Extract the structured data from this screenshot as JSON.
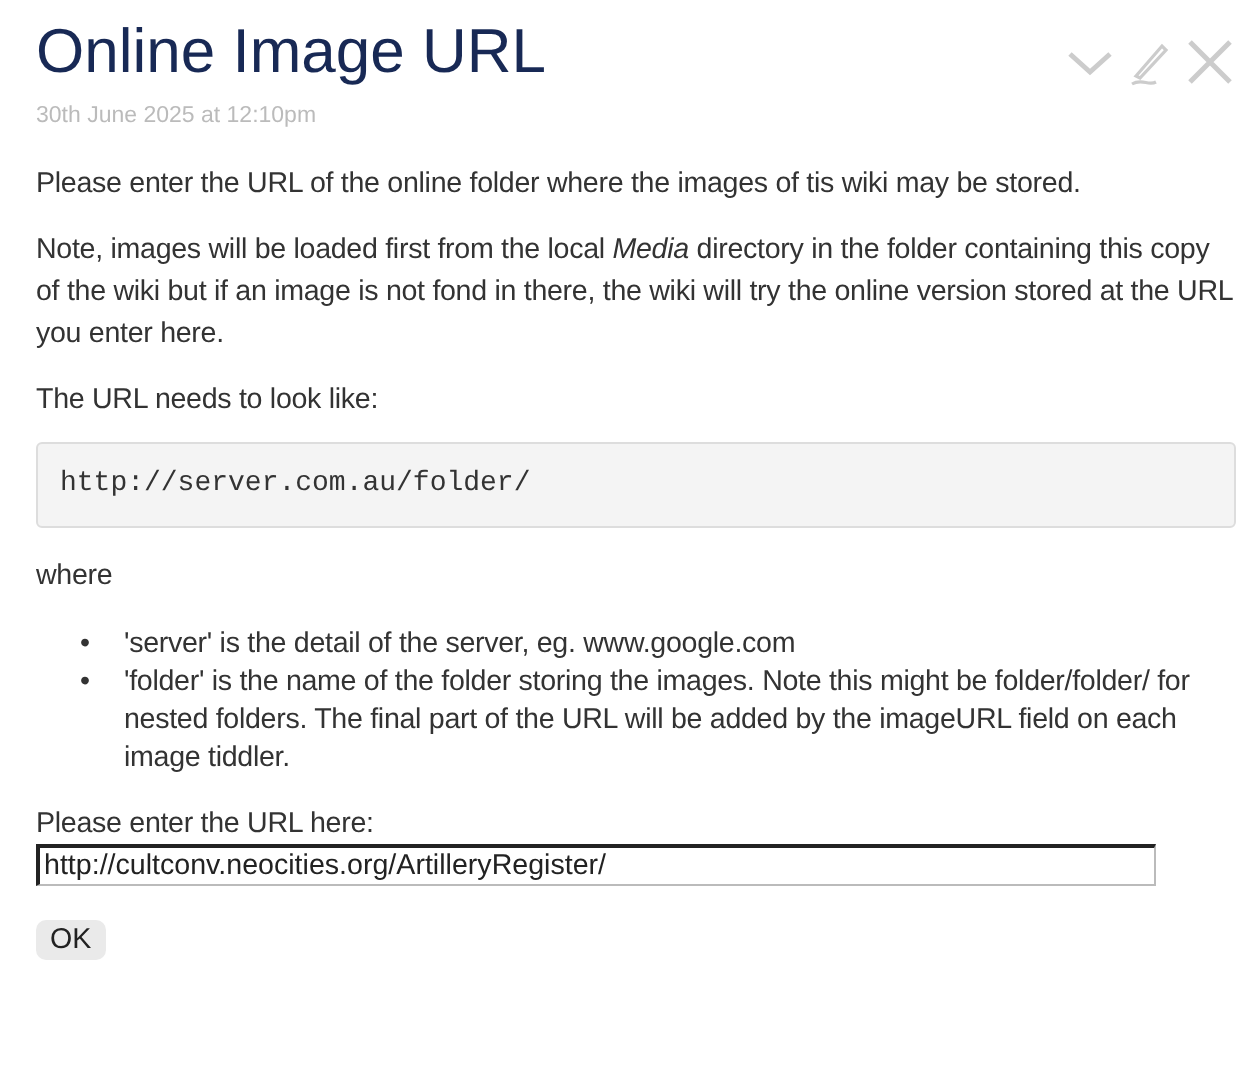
{
  "tiddler": {
    "title": "Online Image URL",
    "subtitle": "30th June 2025 at 12:10pm"
  },
  "toolbar": [
    {
      "kind": "fold"
    },
    {
      "kind": "edit"
    },
    {
      "kind": "close"
    }
  ],
  "body": {
    "intro": "Please enter the URL of the online folder where the images of tis wiki may be stored.",
    "note": "Note, images will be loaded first from the local *Media* directory in the folder containing this copy of the wiki but if an image is not fond in there, the wiki will try the online version stored at the URL you enter here.",
    "format_label": "The URL needs to look like:",
    "code": "http://server.com.au/folder/",
    "where": "where",
    "bullets": [
      {
        "marker": "•",
        "text": "'server' is the detail of the server, eg. www.google.com"
      },
      {
        "marker": "•",
        "text": "'folder' is the name of the folder storing the images. Note this might be folder/folder/ for nested folders. The final part of the URL will be added by the imageURL field on each image tiddler."
      }
    ],
    "field_label": "Please enter the URL here:",
    "field_value": "http://cultconv.neocities.org/ArtilleryRegister/",
    "button": "OK"
  }
}
